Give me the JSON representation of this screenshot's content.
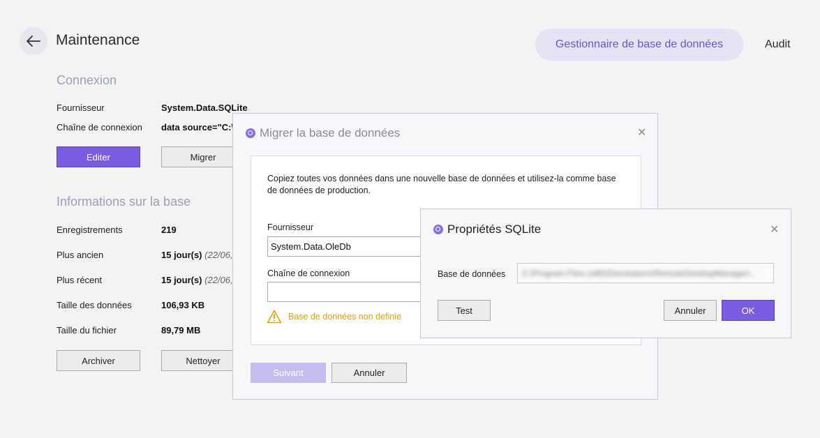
{
  "header": {
    "title": "Maintenance",
    "nav_active": "Gestionnaire de base de données",
    "nav_audit": "Audit"
  },
  "connexion": {
    "title": "Connexion",
    "fournisseur_label": "Fournisseur",
    "fournisseur_value": "System.Data.SQLite",
    "chaine_label": "Chaîne de connexion",
    "chaine_value": "data source=\"C:\\",
    "editer_label": "Editer",
    "migrer_label": "Migrer"
  },
  "infos": {
    "title": "Informations sur la base",
    "rows": [
      {
        "label": "Enregistrements",
        "value": "219",
        "extra": ""
      },
      {
        "label": "Plus ancien",
        "value": "15 jour(s)",
        "extra": "(22/06,"
      },
      {
        "label": "Plus récent",
        "value": "15 jour(s)",
        "extra": "(22/06,"
      },
      {
        "label": "Taille des données",
        "value": "106,93 KB",
        "extra": ""
      },
      {
        "label": "Taille du fichier",
        "value": "89,79 MB",
        "extra": ""
      }
    ],
    "archiver_label": "Archiver",
    "nettoyer_label": "Nettoyer"
  },
  "migrate_dialog": {
    "title": "Migrer la base de données",
    "description": "Copiez toutes vos données dans une nouvelle base de données et utilisez-la comme base de données de production.",
    "fournisseur_label": "Fournisseur",
    "fournisseur_value": "System.Data.OleDb",
    "chaine_label": "Chaîne de connexion",
    "chaine_value": "",
    "warning_text": "Base de données non definie",
    "suivant_label": "Suivant",
    "annuler_label": "Annuler"
  },
  "sqlite_dialog": {
    "title": "Propriétés SQLite",
    "db_label": "Base de données",
    "db_value_obscured": "C:\\Program Files (x86)\\Devolutions\\RemoteDesktopManager\\...",
    "test_label": "Test",
    "annuler_label": "Annuler",
    "ok_label": "OK"
  },
  "colors": {
    "accent": "#7a5ce0",
    "accent_soft": "#e4e3f3",
    "warning": "#e2a100",
    "section_title": "#9aa0b2"
  }
}
